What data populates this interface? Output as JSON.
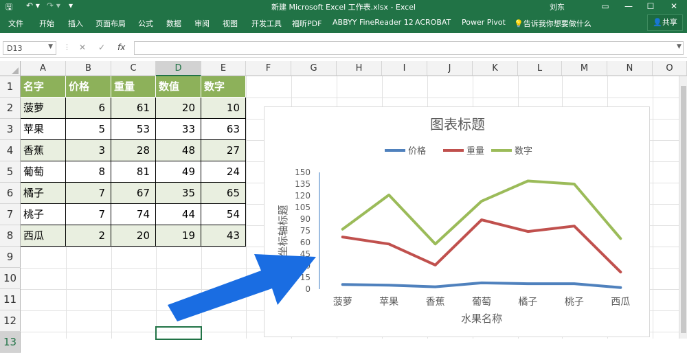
{
  "title_bar": {
    "title": "新建 Microsoft Excel 工作表.xlsx  -  Excel",
    "user": "刘东",
    "icons": [
      "save-icon",
      "undo-icon",
      "redo-icon",
      "customize-icon",
      "ribbon-display-icon",
      "minimize-icon",
      "maximize-icon",
      "close-icon"
    ]
  },
  "ribbon": {
    "tabs": [
      "文件",
      "开始",
      "插入",
      "页面布局",
      "公式",
      "数据",
      "审阅",
      "视图",
      "开发工具",
      "福昕PDF",
      "ABBYY FineReader 12",
      "ACROBAT",
      "Power Pivot"
    ],
    "tell_me": "告诉我你想要做什么",
    "share": "共享"
  },
  "formula_bar": {
    "name_box": "D13",
    "fx": "fx",
    "content": ""
  },
  "columns": [
    "A",
    "B",
    "C",
    "D",
    "E",
    "F",
    "G",
    "H",
    "I",
    "J",
    "K",
    "L",
    "M",
    "N",
    "O"
  ],
  "rows": [
    "1",
    "2",
    "3",
    "4",
    "5",
    "6",
    "7",
    "8",
    "9",
    "10",
    "11",
    "12",
    "13"
  ],
  "selected_cell": "D13",
  "table": {
    "headers": [
      "名字",
      "价格",
      "重量",
      "数值",
      "数字"
    ],
    "rows": [
      [
        "菠萝",
        "6",
        "61",
        "20",
        "10"
      ],
      [
        "苹果",
        "5",
        "53",
        "33",
        "63"
      ],
      [
        "香蕉",
        "3",
        "28",
        "48",
        "27"
      ],
      [
        "葡萄",
        "8",
        "81",
        "49",
        "24"
      ],
      [
        "橘子",
        "7",
        "67",
        "35",
        "65"
      ],
      [
        "桃子",
        "7",
        "74",
        "44",
        "54"
      ],
      [
        "西瓜",
        "2",
        "20",
        "19",
        "43"
      ]
    ]
  },
  "chart_data": {
    "type": "line",
    "title": "图表标题",
    "xlabel": "水果名称",
    "ylabel": "坐标轴标题",
    "categories": [
      "菠萝",
      "苹果",
      "香蕉",
      "葡萄",
      "橘子",
      "桃子",
      "西瓜"
    ],
    "yticks": [
      "0",
      "15",
      "30",
      "45",
      "60",
      "75",
      "90",
      "105",
      "120",
      "135",
      "150"
    ],
    "ylim": [
      0,
      150
    ],
    "stacked": true,
    "legend_position": "top",
    "gridlines": false,
    "series": [
      {
        "name": "价格",
        "color": "#4f81bd",
        "values": [
          6,
          5,
          3,
          8,
          7,
          7,
          2
        ]
      },
      {
        "name": "重量",
        "color": "#c0504d",
        "values": [
          61,
          53,
          28,
          81,
          67,
          74,
          20
        ]
      },
      {
        "name": "数字",
        "color": "#9bbb59",
        "values": [
          10,
          63,
          27,
          24,
          65,
          54,
          43
        ]
      }
    ],
    "annotation": "blue-arrow-pointing-to-axis-title"
  }
}
